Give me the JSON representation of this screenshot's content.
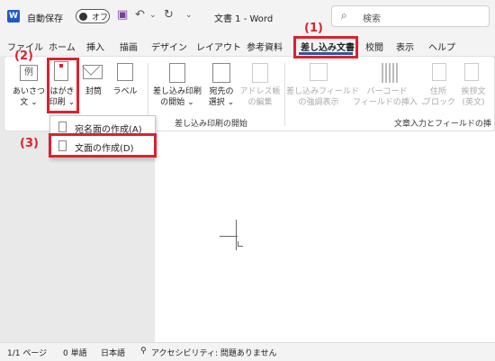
{
  "titlebar": {
    "app_icon": "W",
    "autosave_label": "自動保存",
    "toggle_state": "オフ",
    "doc_title": "文書 1  -  Word",
    "search_placeholder": "検索"
  },
  "tabs": [
    "ファイル",
    "ホーム",
    "挿入",
    "描画",
    "デザイン",
    "レイアウト",
    "参考資料",
    "差し込み文書",
    "校閲",
    "表示",
    "ヘルプ"
  ],
  "active_tab": "差し込み文書",
  "ribbon": {
    "buttons": {
      "aisatsu": "あいさつ\n文 ⌄",
      "hagaki": "はがき\n印刷 ⌄",
      "futo": "封筒",
      "label": "ラベル",
      "merge_start": "差し込み印刷\nの開始 ⌄",
      "recipients": "宛先の\n選択 ⌄",
      "address_edit": "アドレス帳\nの編集",
      "highlight_fields": "差し込みフィールド\nの強調表示",
      "barcode": "バーコード\nフィールドの挿入 ⌄",
      "address_block": "住所\nブロック",
      "greeting": "挨拶文\n(英文)"
    },
    "group_merge_start": "差し込み印刷の開始",
    "group_fields": "文章入力とフィールドの挿"
  },
  "menu": {
    "item1": "宛名面の作成(A)",
    "item2": "文面の作成(D)"
  },
  "annotations": {
    "a1": "(1)",
    "a2": "(2)",
    "a3": "(3)"
  },
  "status": {
    "page": "1/1 ページ",
    "words": "0 単語",
    "lang": "日本語",
    "accessibility": "アクセシビリティ: 問題ありません"
  },
  "colors": {
    "accent": "#2b579a",
    "annotation": "#d9232d"
  }
}
